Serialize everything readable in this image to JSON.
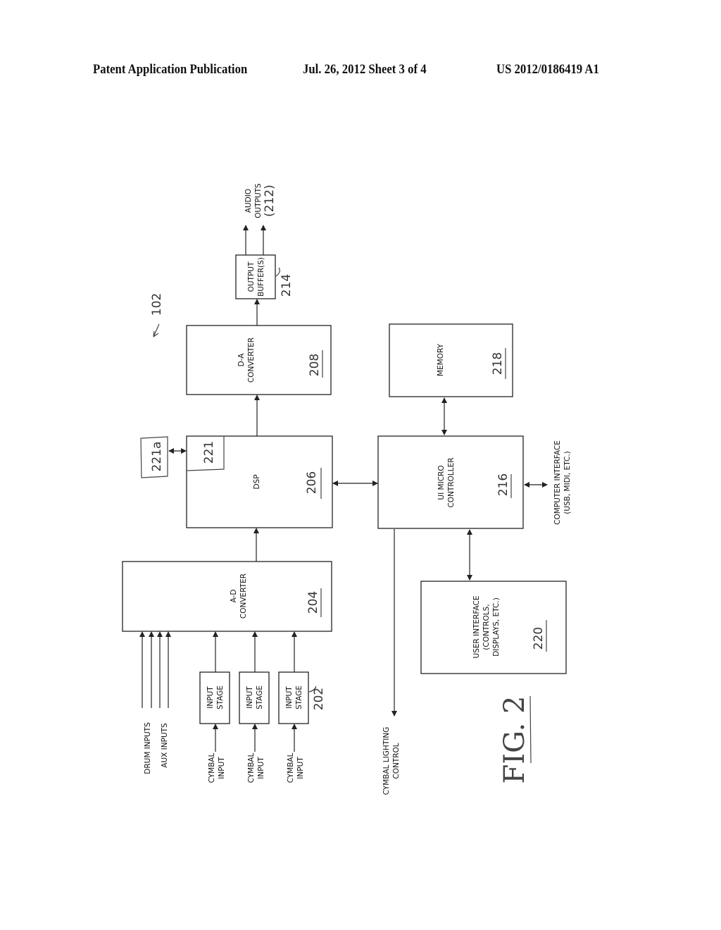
{
  "header": {
    "publication": "Patent Application Publication",
    "date_sheet": "Jul. 26, 2012   Sheet 3 of 4",
    "number": "US 2012/0186419 A1"
  },
  "figure": {
    "label": "FIG. 2",
    "ref": "102",
    "blocks": {
      "output_buffer": {
        "lines": [
          "OUTPUT",
          "BUFFER(S)"
        ],
        "ref": "214"
      },
      "da_converter": {
        "lines": [
          "D-A",
          "CONVERTER"
        ],
        "ref": "208"
      },
      "dsp": {
        "lines": [
          "DSP"
        ],
        "ref": "206"
      },
      "dsp_sub": {
        "ref": "221"
      },
      "ext_221a": {
        "ref": "221a"
      },
      "ad_converter": {
        "lines": [
          "A-D",
          "CONVERTER"
        ],
        "ref": "204"
      },
      "memory": {
        "lines": [
          "MEMORY"
        ],
        "ref": "218"
      },
      "ui_micro": {
        "lines": [
          "UI MICRO",
          "CONTROLLER"
        ],
        "ref": "216"
      },
      "user_interface": {
        "lines": [
          "USER INTERFACE",
          "(CONTROLS,",
          "DISPLAYS, ETC.)"
        ],
        "ref": "220"
      },
      "input_stage": {
        "lines": [
          "INPUT",
          "STAGE"
        ],
        "ref": "202"
      }
    },
    "labels": {
      "audio_outputs": [
        "AUDIO",
        "OUTPUTS"
      ],
      "audio_outputs_ref": "(212)",
      "computer_interface": [
        "COMPUTER INTERFACE",
        "(USB, MIDI, ETC.)"
      ],
      "cymbal_lighting": [
        "CYMBAL LIGHTING",
        "CONTROL"
      ],
      "drum_inputs": "DRUM INPUTS",
      "aux_inputs": "AUX INPUTS",
      "cymbal_input": [
        "CYMBAL",
        "INPUT"
      ]
    }
  }
}
